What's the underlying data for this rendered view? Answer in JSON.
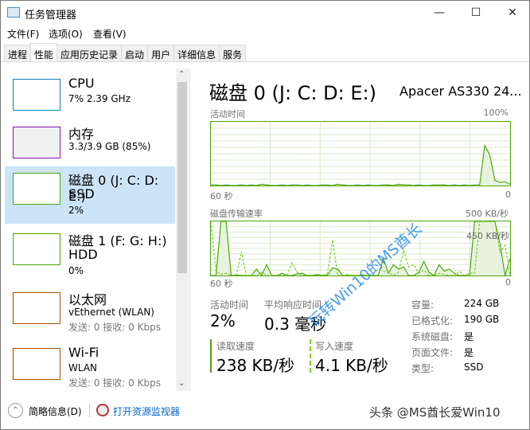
{
  "window": {
    "title": "任务管理器",
    "controls": [
      "minimize",
      "maximize",
      "close"
    ]
  },
  "menu": [
    "文件(F)",
    "选项(O)",
    "查看(V)"
  ],
  "tabs": [
    "进程",
    "性能",
    "应用历史记录",
    "启动",
    "用户",
    "详细信息",
    "服务"
  ],
  "active_tab": "性能",
  "sidebar": [
    {
      "name": "CPU",
      "sub": "7% 2.39 GHz",
      "color": "#117dbb"
    },
    {
      "name": "内存",
      "sub": "3.3/3.9 GB (85%)",
      "color": "#8b12ae"
    },
    {
      "name": "磁盘 0 (J: C: D: E:)",
      "sub": "SSD",
      "sub2": "2%",
      "color": "#4da60c",
      "selected": true
    },
    {
      "name": "磁盘 1 (F: G: H:)",
      "sub": "HDD",
      "sub2": "0%",
      "color": "#4da60c"
    },
    {
      "name": "以太网",
      "sub": "vEthernet (WLAN)",
      "sub2": "发送: 0 接收: 0 Kbps",
      "color": "#a74f01"
    },
    {
      "name": "Wi-Fi",
      "sub": "WLAN",
      "sub2": "发送: 0 接收: 0 Kbps",
      "color": "#a74f01"
    }
  ],
  "main": {
    "title": "磁盘 0 (J: C: D: E:)",
    "model": "Apacer AS330 24...",
    "graph1": {
      "label": "活动时间",
      "max": "100%",
      "left": "60 秒",
      "right": "0",
      "values": [
        1,
        1,
        0,
        1,
        0,
        0,
        1,
        0,
        1,
        0,
        2,
        1,
        0,
        0,
        1,
        0,
        1,
        1,
        0,
        1,
        0,
        0,
        1,
        1,
        0,
        2,
        1,
        0,
        0,
        1,
        0,
        1,
        0,
        0,
        1,
        1,
        0,
        2,
        1,
        1,
        0,
        1,
        0,
        0,
        1,
        1,
        1,
        0,
        1,
        0,
        1,
        0,
        1,
        1,
        63,
        48,
        8,
        5,
        6,
        2
      ]
    },
    "graph2": {
      "label": "磁盘传输速率",
      "max": "500 KB/秒",
      "marker": "450 KB/秒",
      "left": "60 秒",
      "right": "0",
      "read": [
        0,
        0,
        500,
        500,
        0,
        5,
        0,
        0,
        0,
        60,
        0,
        100,
        0,
        0,
        20,
        0,
        0,
        15,
        20,
        0,
        0,
        10,
        0,
        5,
        70,
        60,
        0,
        0,
        0,
        0,
        0,
        0,
        0,
        0,
        160,
        20,
        100,
        60,
        80,
        0,
        0,
        30,
        130,
        30,
        0,
        100,
        40,
        60,
        20,
        0,
        0,
        0,
        500,
        500,
        500,
        500,
        500,
        300,
        0,
        160
      ],
      "write": [
        500,
        40,
        10,
        20,
        0,
        0,
        220,
        0,
        0,
        0,
        30,
        0,
        0,
        0,
        10,
        0,
        120,
        30,
        0,
        0,
        0,
        0,
        0,
        20,
        330,
        0,
        0,
        10,
        0,
        0,
        10,
        0,
        20,
        60,
        40,
        30,
        0,
        30,
        230,
        80,
        100,
        20,
        50,
        0,
        0,
        20,
        10,
        0,
        0,
        40,
        0,
        20,
        20,
        500,
        500,
        500,
        500,
        210,
        280,
        0
      ]
    },
    "stats": [
      {
        "label": "活动时间",
        "value": "2%"
      },
      {
        "label": "平均响应时间",
        "value": "0.3 毫秒"
      }
    ],
    "speeds": [
      {
        "label": "读取速度",
        "value": "238 KB/秒"
      },
      {
        "label": "写入速度",
        "value": "4.1 KB/秒"
      }
    ],
    "props": [
      {
        "k": "容量:",
        "v": "224 GB"
      },
      {
        "k": "已格式化:",
        "v": "190 GB"
      },
      {
        "k": "系统磁盘:",
        "v": "是"
      },
      {
        "k": "页面文件:",
        "v": "是"
      },
      {
        "k": "类型:",
        "v": "SSD"
      }
    ]
  },
  "footer": {
    "fewer": "简略信息(D)",
    "monitor": "打开资源监视器"
  },
  "watermarks": {
    "diagonal": "玩转Win10的MS酋长",
    "corner": "头条 @MS酋长爱Win10"
  },
  "colors": {
    "disk": "#4da60c",
    "selected": "#cce4f7",
    "link": "#0066cc"
  }
}
